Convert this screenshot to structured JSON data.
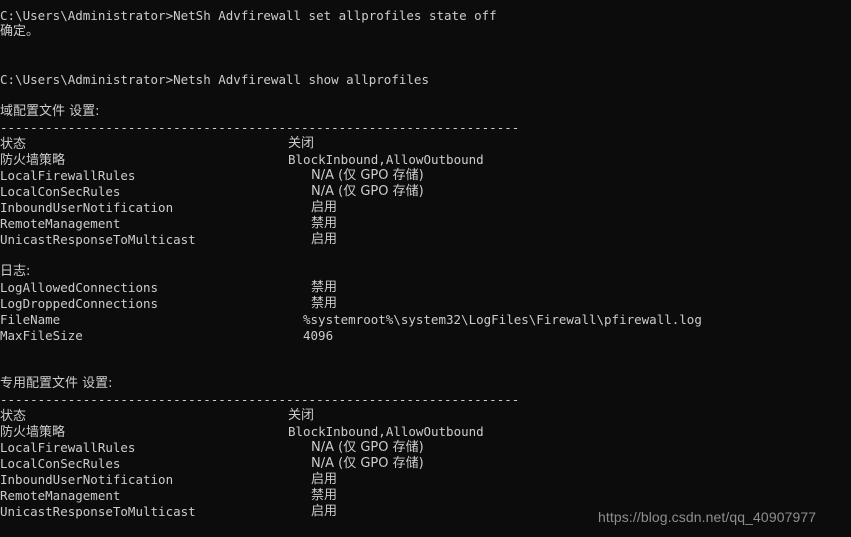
{
  "terminal": {
    "background_color": "#0c0c0c",
    "text_color": "#cccccc",
    "prompt": "C:\\Users\\Administrator>",
    "separator": "---------------------------------------------------------------------",
    "commands": {
      "first": "NetSh Advfirewall set allprofiles state off",
      "first_result": "确定。",
      "second": "Netsh Advfirewall show allprofiles"
    },
    "profiles": [
      {
        "heading": "域配置文件 设置:",
        "settings": [
          {
            "key": "状态",
            "value": "关闭",
            "key_cjk": true,
            "value_cjk": true
          },
          {
            "key": "防火墙策略",
            "value": "BlockInbound,AllowOutbound",
            "key_cjk": true,
            "value_cjk": false
          },
          {
            "key": "LocalFirewallRules",
            "value": "N/A (仅 GPO 存储)",
            "key_cjk": false,
            "value_cjk": true
          },
          {
            "key": "LocalConSecRules",
            "value": "N/A (仅 GPO 存储)",
            "key_cjk": false,
            "value_cjk": true
          },
          {
            "key": "InboundUserNotification",
            "value": "启用",
            "key_cjk": false,
            "value_cjk": true
          },
          {
            "key": "RemoteManagement",
            "value": "禁用",
            "key_cjk": false,
            "value_cjk": true
          },
          {
            "key": "UnicastResponseToMulticast",
            "value": "启用",
            "key_cjk": false,
            "value_cjk": true
          }
        ],
        "logging": {
          "heading": "日志:",
          "settings": [
            {
              "key": "LogAllowedConnections",
              "value": "禁用",
              "value_cjk": true
            },
            {
              "key": "LogDroppedConnections",
              "value": "禁用",
              "value_cjk": true
            },
            {
              "key": "FileName",
              "value": "%systemroot%\\system32\\LogFiles\\Firewall\\pfirewall.log",
              "value_cjk": false
            },
            {
              "key": "MaxFileSize",
              "value": "4096",
              "value_cjk": false
            }
          ]
        }
      },
      {
        "heading": "专用配置文件 设置:",
        "settings": [
          {
            "key": "状态",
            "value": "关闭",
            "key_cjk": true,
            "value_cjk": true
          },
          {
            "key": "防火墙策略",
            "value": "BlockInbound,AllowOutbound",
            "key_cjk": true,
            "value_cjk": false
          },
          {
            "key": "LocalFirewallRules",
            "value": "N/A (仅 GPO 存储)",
            "key_cjk": false,
            "value_cjk": true
          },
          {
            "key": "LocalConSecRules",
            "value": "N/A (仅 GPO 存储)",
            "key_cjk": false,
            "value_cjk": true
          },
          {
            "key": "InboundUserNotification",
            "value": "启用",
            "key_cjk": false,
            "value_cjk": true
          },
          {
            "key": "RemoteManagement",
            "value": "禁用",
            "key_cjk": false,
            "value_cjk": true
          },
          {
            "key": "UnicastResponseToMulticast",
            "value": "启用",
            "key_cjk": false,
            "value_cjk": true
          }
        ]
      }
    ],
    "watermark": "https://blog.csdn.net/qq_40907977"
  }
}
